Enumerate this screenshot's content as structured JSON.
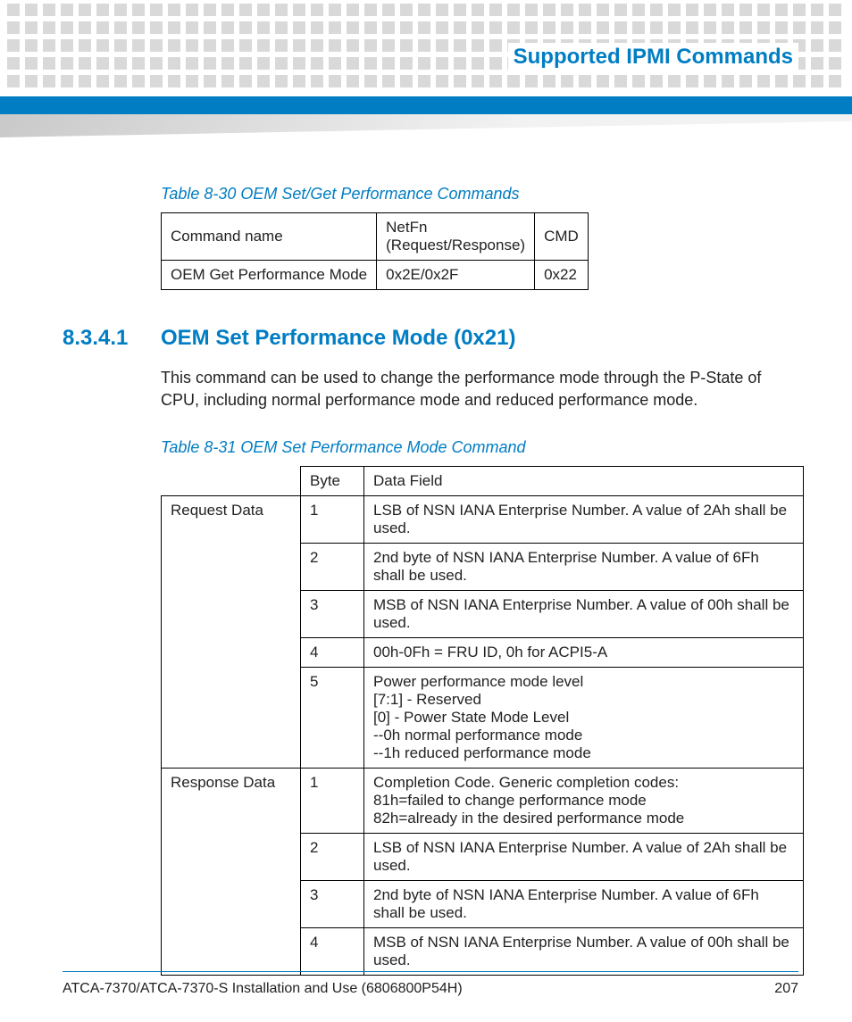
{
  "header": {
    "section_title": "Supported IPMI Commands"
  },
  "table_830": {
    "caption": "Table 8-30 OEM Set/Get Performance Commands",
    "h1": "Command name",
    "h2": "NetFn\n(Request/Response)",
    "h3": "CMD",
    "r1c1": "OEM Get Performance Mode",
    "r1c2": "0x2E/0x2F",
    "r1c3": "0x22"
  },
  "section_8341": {
    "number": "8.3.4.1",
    "title": "OEM Set Performance Mode (0x21)",
    "body": "This command can be used to change the performance mode through the P-State of CPU, including normal performance mode and reduced performance mode."
  },
  "table_831": {
    "caption": "Table 8-31 OEM Set Performance Mode Command",
    "h_byte": "Byte",
    "h_field": "Data Field",
    "request_label": "Request Data",
    "response_label": "Response Data",
    "req": [
      {
        "byte": "1",
        "field": "LSB of NSN IANA Enterprise Number. A value of 2Ah shall be used."
      },
      {
        "byte": "2",
        "field": "2nd byte of NSN IANA Enterprise Number. A value of 6Fh shall be used."
      },
      {
        "byte": "3",
        "field": "MSB of NSN IANA Enterprise Number. A value of 00h shall be used."
      },
      {
        "byte": "4",
        "field": "00h-0Fh = FRU ID, 0h for ACPI5-A"
      },
      {
        "byte": "5",
        "field": "Power performance mode level\n[7:1] - Reserved\n[0] - Power State Mode Level\n--0h normal performance mode\n--1h reduced performance mode"
      }
    ],
    "res": [
      {
        "byte": "1",
        "field": "Completion Code. Generic completion codes:\n81h=failed to change performance mode\n82h=already in the desired performance mode"
      },
      {
        "byte": "2",
        "field": "LSB of NSN IANA Enterprise Number. A value of 2Ah shall be used."
      },
      {
        "byte": "3",
        "field": "2nd byte of NSN IANA Enterprise Number. A value of 6Fh shall be used."
      },
      {
        "byte": "4",
        "field": "MSB of NSN IANA Enterprise Number. A value of 00h shall be used."
      }
    ]
  },
  "footer": {
    "doc": "ATCA-7370/ATCA-7370-S Installation and Use (6806800P54H)",
    "page": "207"
  }
}
